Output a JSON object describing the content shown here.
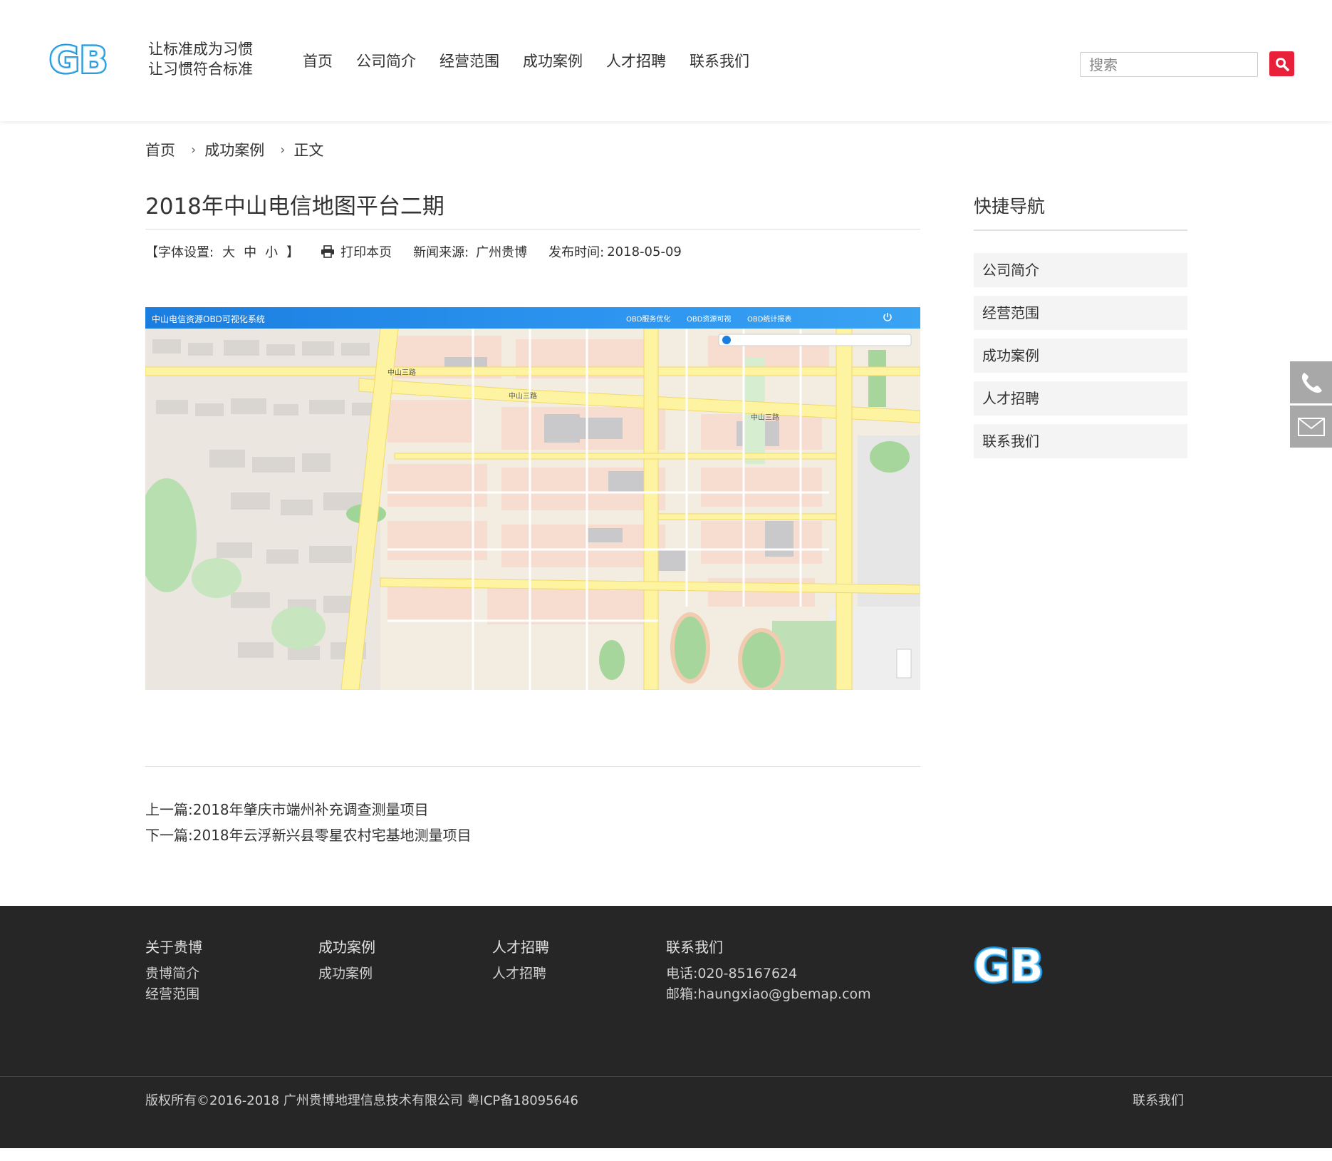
{
  "header": {
    "slogan_line1": "让标准成为习惯",
    "slogan_line2": "让习惯符合标准",
    "nav": [
      "首页",
      "公司简介",
      "经营范围",
      "成功案例",
      "人才招聘",
      "联系我们"
    ],
    "search_placeholder": "搜索",
    "logo_text": "GB"
  },
  "breadcrumb": {
    "home": "首页",
    "section": "成功案例",
    "current": "正文"
  },
  "article": {
    "title": "2018年中山电信地图平台二期",
    "font_setting_label": "【字体设置:",
    "font_large": "大",
    "font_medium": "中",
    "font_small": "小",
    "font_setting_end": "】",
    "print_label": "打印本页",
    "source_label": "新闻来源:",
    "source_value": "广州贵博",
    "date_label": "发布时间:",
    "date_value": "2018-05-09",
    "image": {
      "system_title": "中山电信资源OBD可视化系统",
      "toolbar": [
        "OBD服务优化",
        "OBD资源可视",
        "OBD统计报表"
      ]
    },
    "prev_label": "上一篇:",
    "prev_title": "2018年肇庆市端州补充调查测量项目",
    "next_label": "下一篇:",
    "next_title": "2018年云浮新兴县零星农村宅基地测量项目"
  },
  "sidebar": {
    "title": "快捷导航",
    "items": [
      "公司简介",
      "经营范围",
      "成功案例",
      "人才招聘",
      "联系我们"
    ]
  },
  "footer": {
    "col1": {
      "heading": "关于贵博",
      "links": [
        "贵博简介",
        "经营范围"
      ]
    },
    "col2": {
      "heading": "成功案例",
      "links": [
        "成功案例"
      ]
    },
    "col3": {
      "heading": "人才招聘",
      "links": [
        "人才招聘"
      ]
    },
    "col4": {
      "heading": "联系我们",
      "phone": "电话:020-85167624",
      "email": "邮箱:haungxiao@gbemap.com"
    },
    "copyright": "版权所有©2016-2018 广州贵博地理信息技术有限公司 粤ICP备18095646",
    "contact_link": "联系我们"
  },
  "colors": {
    "brand_blue": "#1a8fd8",
    "search_red": "#e8203a",
    "footer_bg": "#262626"
  }
}
